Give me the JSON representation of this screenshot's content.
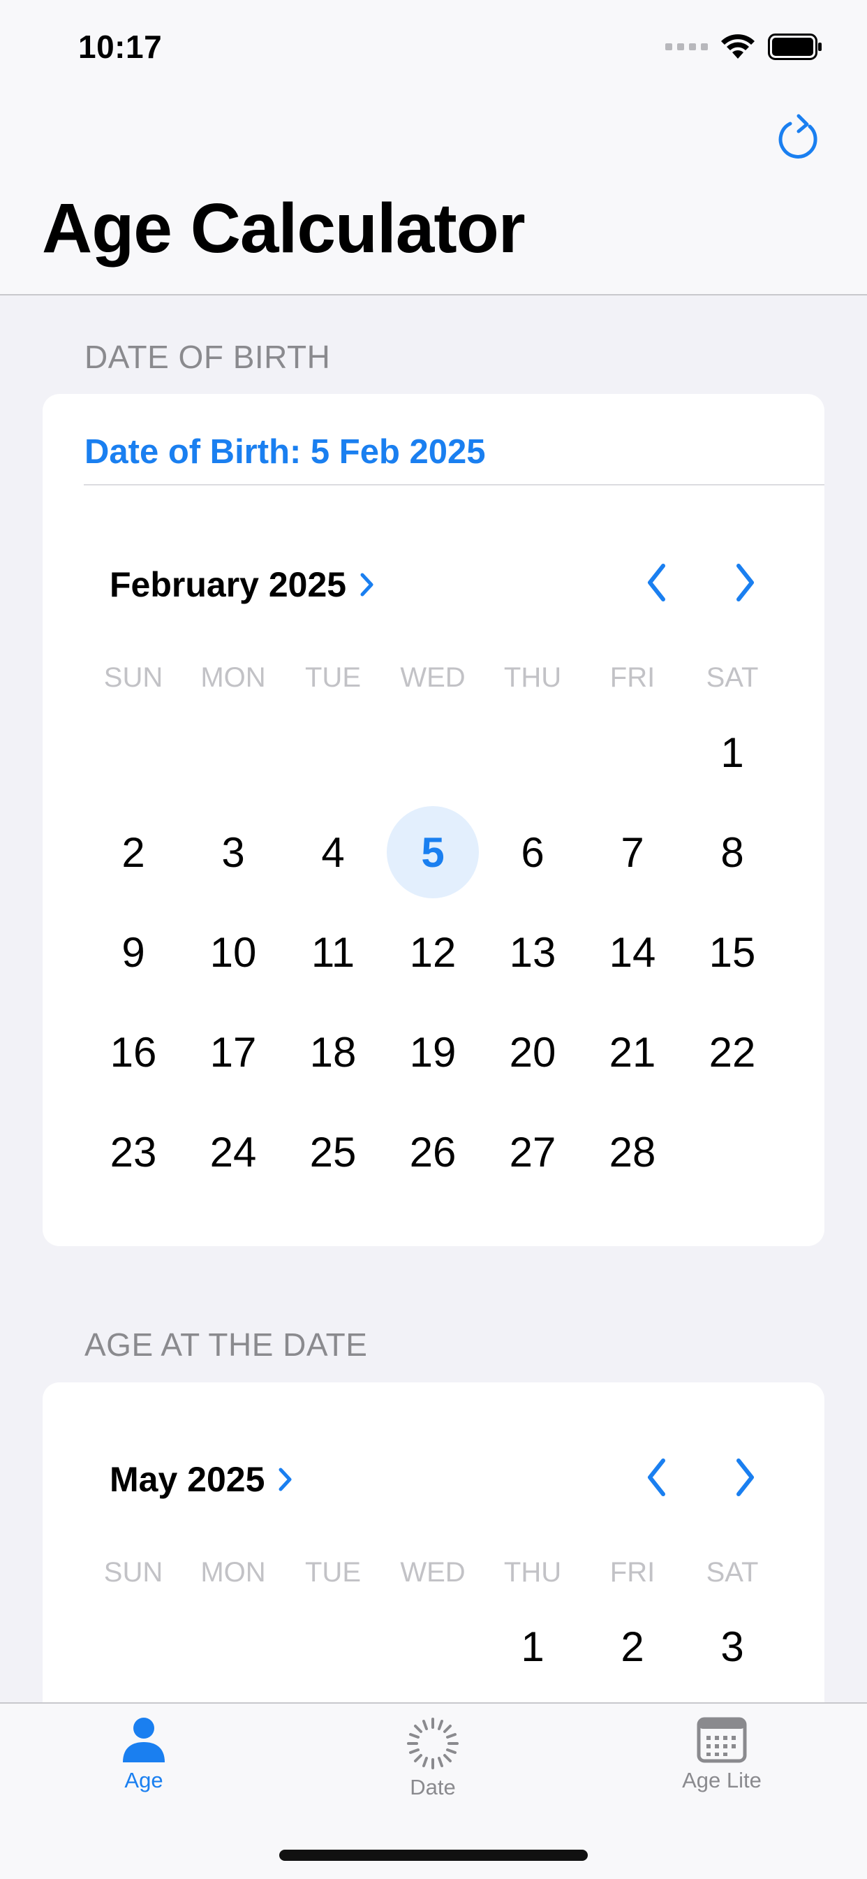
{
  "status": {
    "time": "10:17"
  },
  "header": {
    "title": "Age Calculator"
  },
  "dob_section": {
    "header": "DATE OF BIRTH",
    "selected_text": "Date of Birth: 5 Feb 2025",
    "calendar": {
      "month_label": "February 2025",
      "weekdays": [
        "SUN",
        "MON",
        "TUE",
        "WED",
        "THU",
        "FRI",
        "SAT"
      ],
      "days": [
        [
          "",
          "",
          "",
          "",
          "",
          "",
          "1"
        ],
        [
          "2",
          "3",
          "4",
          "5",
          "6",
          "7",
          "8"
        ],
        [
          "9",
          "10",
          "11",
          "12",
          "13",
          "14",
          "15"
        ],
        [
          "16",
          "17",
          "18",
          "19",
          "20",
          "21",
          "22"
        ],
        [
          "23",
          "24",
          "25",
          "26",
          "27",
          "28",
          ""
        ]
      ],
      "selected_day": "5"
    }
  },
  "age_section": {
    "header": "AGE AT THE DATE",
    "calendar": {
      "month_label": "May 2025",
      "weekdays": [
        "SUN",
        "MON",
        "TUE",
        "WED",
        "THU",
        "FRI",
        "SAT"
      ],
      "days": [
        [
          "",
          "",
          "",
          "",
          "1",
          "2",
          "3"
        ]
      ]
    }
  },
  "tabbar": {
    "tabs": [
      {
        "label": "Age",
        "icon": "person-icon",
        "active": true
      },
      {
        "label": "Date",
        "icon": "spinner-icon",
        "active": false
      },
      {
        "label": "Age Lite",
        "icon": "calendar-icon",
        "active": false
      }
    ]
  },
  "colors": {
    "accent": "#1a7ff0",
    "selected_bg": "#e3effd",
    "background": "#f2f2f7",
    "weekday": "#c2c2c6",
    "inactive_tab": "#8a8a8e"
  }
}
